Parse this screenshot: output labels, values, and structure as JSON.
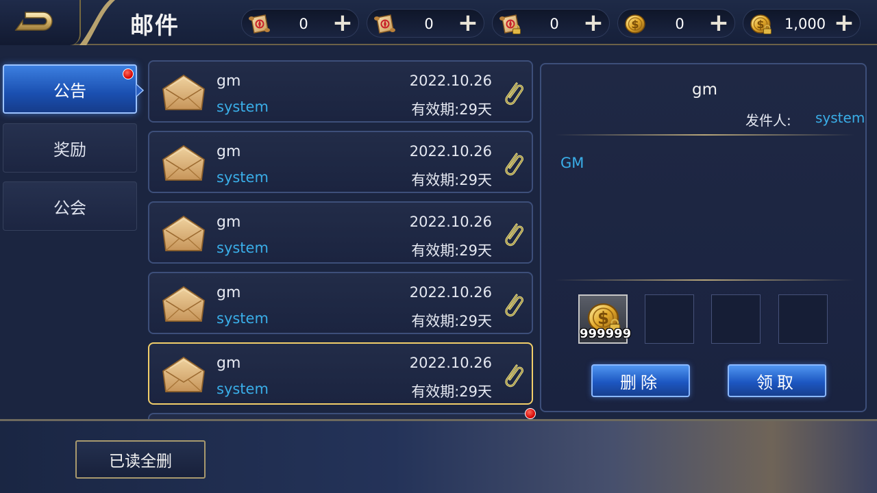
{
  "header": {
    "title": "邮件"
  },
  "currencies": [
    {
      "icon": "scroll-icon",
      "value": "0"
    },
    {
      "icon": "scroll-icon",
      "value": "0"
    },
    {
      "icon": "locked-scroll-icon",
      "value": "0"
    },
    {
      "icon": "gold-coin-icon",
      "value": "0"
    },
    {
      "icon": "locked-gold-coin-icon",
      "value": "1,000"
    }
  ],
  "tabs": [
    {
      "label": "公告",
      "active": true,
      "has_notification": true
    },
    {
      "label": "奖励",
      "active": false,
      "has_notification": false
    },
    {
      "label": "公会",
      "active": false,
      "has_notification": false
    }
  ],
  "mails": [
    {
      "title": "gm",
      "sender": "system",
      "date": "2022.10.26",
      "expiry": "有效期:29天",
      "selected": false
    },
    {
      "title": "gm",
      "sender": "system",
      "date": "2022.10.26",
      "expiry": "有效期:29天",
      "selected": false
    },
    {
      "title": "gm",
      "sender": "system",
      "date": "2022.10.26",
      "expiry": "有效期:29天",
      "selected": false
    },
    {
      "title": "gm",
      "sender": "system",
      "date": "2022.10.26",
      "expiry": "有效期:29天",
      "selected": false
    },
    {
      "title": "gm",
      "sender": "system",
      "date": "2022.10.26",
      "expiry": "有效期:29天",
      "selected": true
    }
  ],
  "detail": {
    "title": "gm",
    "sender_label": "发件人:",
    "sender_value": "system",
    "body": "GM",
    "attachment_count": "999999",
    "delete_label": "删除",
    "claim_label": "领取"
  },
  "footer": {
    "read_delete_label": "已读全删"
  },
  "colors": {
    "accent_blue": "#3aaee8",
    "selected_border": "#f2cf6a",
    "panel_border": "#3d4f7a"
  }
}
